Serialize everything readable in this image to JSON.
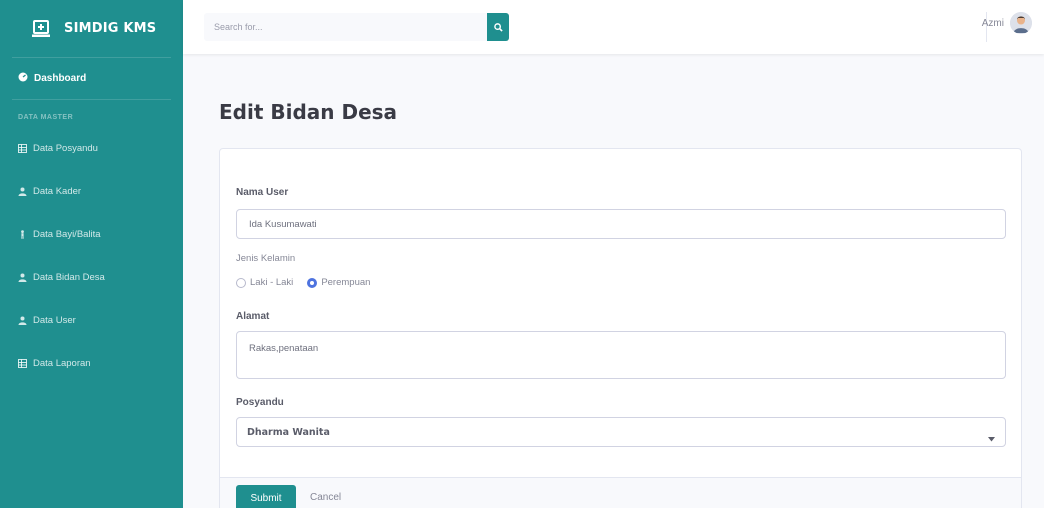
{
  "brand": {
    "name": "SIMDIG KMS",
    "icon": "laptop-plus-icon"
  },
  "sidebar": {
    "dashboard": {
      "label": "Dashboard",
      "icon": "tachometer-icon"
    },
    "heading": "DATA MASTER",
    "items": [
      {
        "label": "Data Posyandu",
        "icon": "table-icon"
      },
      {
        "label": "Data Kader",
        "icon": "user-icon"
      },
      {
        "label": "Data Bayi/Balita",
        "icon": "child-icon"
      },
      {
        "label": "Data Bidan Desa",
        "icon": "user-icon"
      },
      {
        "label": "Data User",
        "icon": "user-icon"
      },
      {
        "label": "Data Laporan",
        "icon": "table-icon"
      }
    ],
    "color": "#1f8f8f"
  },
  "topbar": {
    "search_placeholder": "Search for...",
    "user_name": "Azmi"
  },
  "page": {
    "title": "Edit Bidan Desa",
    "form": {
      "nama_user_label": "Nama User",
      "nama_user_value": "Ida Kusumawati",
      "jenis_kelamin_label": "Jenis Kelamin",
      "gender_options": [
        "Laki - Laki",
        "Perempuan"
      ],
      "gender_selected": "Perempuan",
      "alamat_label": "Alamat",
      "alamat_value": "Rakas,penataan",
      "posyandu_label": "Posyandu",
      "posyandu_value": "Dharma Wanita"
    },
    "submit_label": "Submit",
    "cancel_label": "Cancel"
  },
  "colors": {
    "primary": "#1f8f8f",
    "radio_accent": "#4e73df"
  }
}
